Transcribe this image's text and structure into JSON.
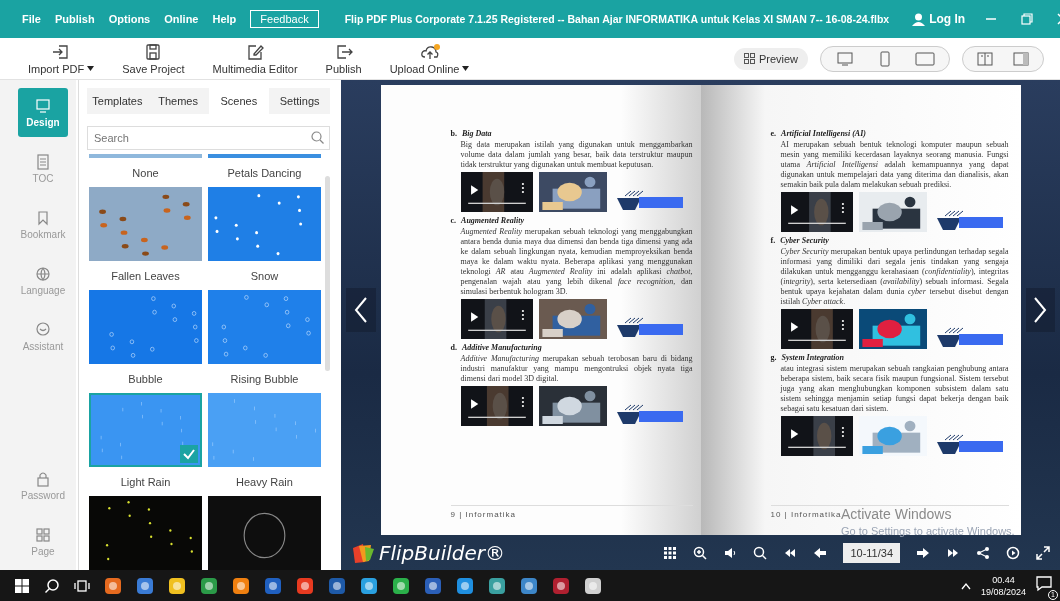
{
  "title_bar": {
    "menu": [
      {
        "label": "File",
        "kind": "item"
      },
      {
        "label": "Publish",
        "kind": "item"
      },
      {
        "label": "Options",
        "kind": "item"
      },
      {
        "label": "Online",
        "kind": "item"
      },
      {
        "label": "Help",
        "kind": "item"
      },
      {
        "label": "Feedback",
        "kind": "boxed"
      }
    ],
    "title": "Flip PDF Plus Corporate 7.1.25 Registered -- Bahan Ajar INFORMATIKA untuk Kelas XI SMAN 7-- 16-08-24.flbx",
    "account": "Log In"
  },
  "toolbar": {
    "buttons": [
      {
        "label": "Import PDF",
        "dropdown": true
      },
      {
        "label": "Save Project",
        "dropdown": false
      },
      {
        "label": "Multimedia Editor",
        "dropdown": false
      },
      {
        "label": "Publish",
        "dropdown": false
      },
      {
        "label": "Upload Online",
        "dropdown": true
      }
    ],
    "preview": "Preview"
  },
  "side_nav": [
    {
      "label": "Design",
      "selected": true
    },
    {
      "label": "TOC",
      "selected": false
    },
    {
      "label": "Bookmark",
      "selected": false
    },
    {
      "label": "Language",
      "selected": false
    },
    {
      "label": "Assistant",
      "selected": false
    }
  ],
  "side_nav_bottom": [
    {
      "label": "Password",
      "selected": false
    },
    {
      "label": "Page",
      "selected": false
    }
  ],
  "panel": {
    "tabs": [
      {
        "label": "Templates",
        "selected": false
      },
      {
        "label": "Themes",
        "selected": false
      },
      {
        "label": "Scenes",
        "selected": true
      },
      {
        "label": "Settings",
        "selected": false
      }
    ],
    "search": {
      "placeholder": "Search"
    },
    "scenes": [
      {
        "label": "None",
        "selected": false
      },
      {
        "label": "Petals Dancing",
        "selected": false
      },
      {
        "label": "Fallen Leaves",
        "selected": false
      },
      {
        "label": "Snow",
        "selected": false
      },
      {
        "label": "Bubble",
        "selected": false
      },
      {
        "label": "Rising Bubble",
        "selected": false
      },
      {
        "label": "Light Rain",
        "selected": true
      },
      {
        "label": "Heavy Rain",
        "selected": false
      }
    ]
  },
  "book": {
    "left_page": {
      "sections": [
        {
          "marker": "b.",
          "heading": "Big Data",
          "text": "Big data merupakan istilah yang digunakan untuk menggambarkan volume data dalam jumlah yang besar, baik data terstruktur maupun tidak terstruktur yang digunakan untuk membuat keputusan."
        },
        {
          "marker": "c.",
          "heading": "Augmented Reality",
          "text": "*Augmented Reality* merupakan sebuah teknologi yang menggabungkan antara benda dunia maya dua dimensi dan benda tiga dimensi yang ada ke dalam sebuah lingkungan nyata, kemudian memproyeksikan benda maya ke dalam waktu nyata. Beberapa aplikasi yang menggunakan teknologi *AR* atau *Augmented Reality* ini adalah aplikasi *chatbot*, pengenalan wajah atau yang lebih dikenal *face recognition*, dan simulasi berbentuk hologram 3D."
        },
        {
          "marker": "d.",
          "heading": "Additive Manufacturing",
          "text": "*Additive Manufacturing* merupakan sebuah terobosan baru di bidang industri manufaktur yang mampu mengontruksi objek nyata tiga dimensi dari model 3D digital."
        }
      ],
      "footer": "9 | Informatika"
    },
    "right_page": {
      "sections": [
        {
          "marker": "e.",
          "heading": "Artificial Intelligensi (AI)",
          "text": "AI merupakan sebuah bentuk teknologi komputer maupun sebuah mesin yang memiliki kecerdasan layaknya seorang manusia. Fungsi utama *Artificial Intelligensi* adalah kemampuannya yang dapat digunakan untuk mempelajari data yang diterima dan dianalisis, akan semakin baik pula dalam melakukan sebuah prediksi."
        },
        {
          "marker": "f.",
          "heading": "Cyber Security",
          "text": "*Cyber Security* merupakan bentuk upaya perlindungan terhadap segala informasi yang dimiliki dari segala jenis tindakan yang sengaja dilakukan untuk mengganggu kerahasiaan (*confidentiality*), integritas (*integrity*), serta ketersediaan (*availability*) sebuah informasi. Segala bentuk upaya kejahatan dalam dunia *cyber* tersebut disebut dengan istilah *Cyber attack*."
        },
        {
          "marker": "g.",
          "heading": "System Integration",
          "text": "atau integrasi sistem merupakan sebuah rangkaian penghubung antara beberapa sistem, baik secara fisik maupun fungsional. Sistem tersebut juga yang akan menghubungkan komponen subsistem dalam satu sistem sehingga menjamin setiap fungsi dapat bekerja dengan baik sebagai satu kesatuan dari sistem."
        }
      ],
      "footer": "10 | Informatika"
    }
  },
  "viewer_bar": {
    "brand": "FlipBuilder®",
    "page": "10-11/34"
  },
  "os_notice": {
    "title": "Activate Windows",
    "hint": "Go to Settings to activate Windows."
  },
  "taskbar": {
    "time": "00.44",
    "date": "19/08/2024",
    "notifications": "1"
  }
}
